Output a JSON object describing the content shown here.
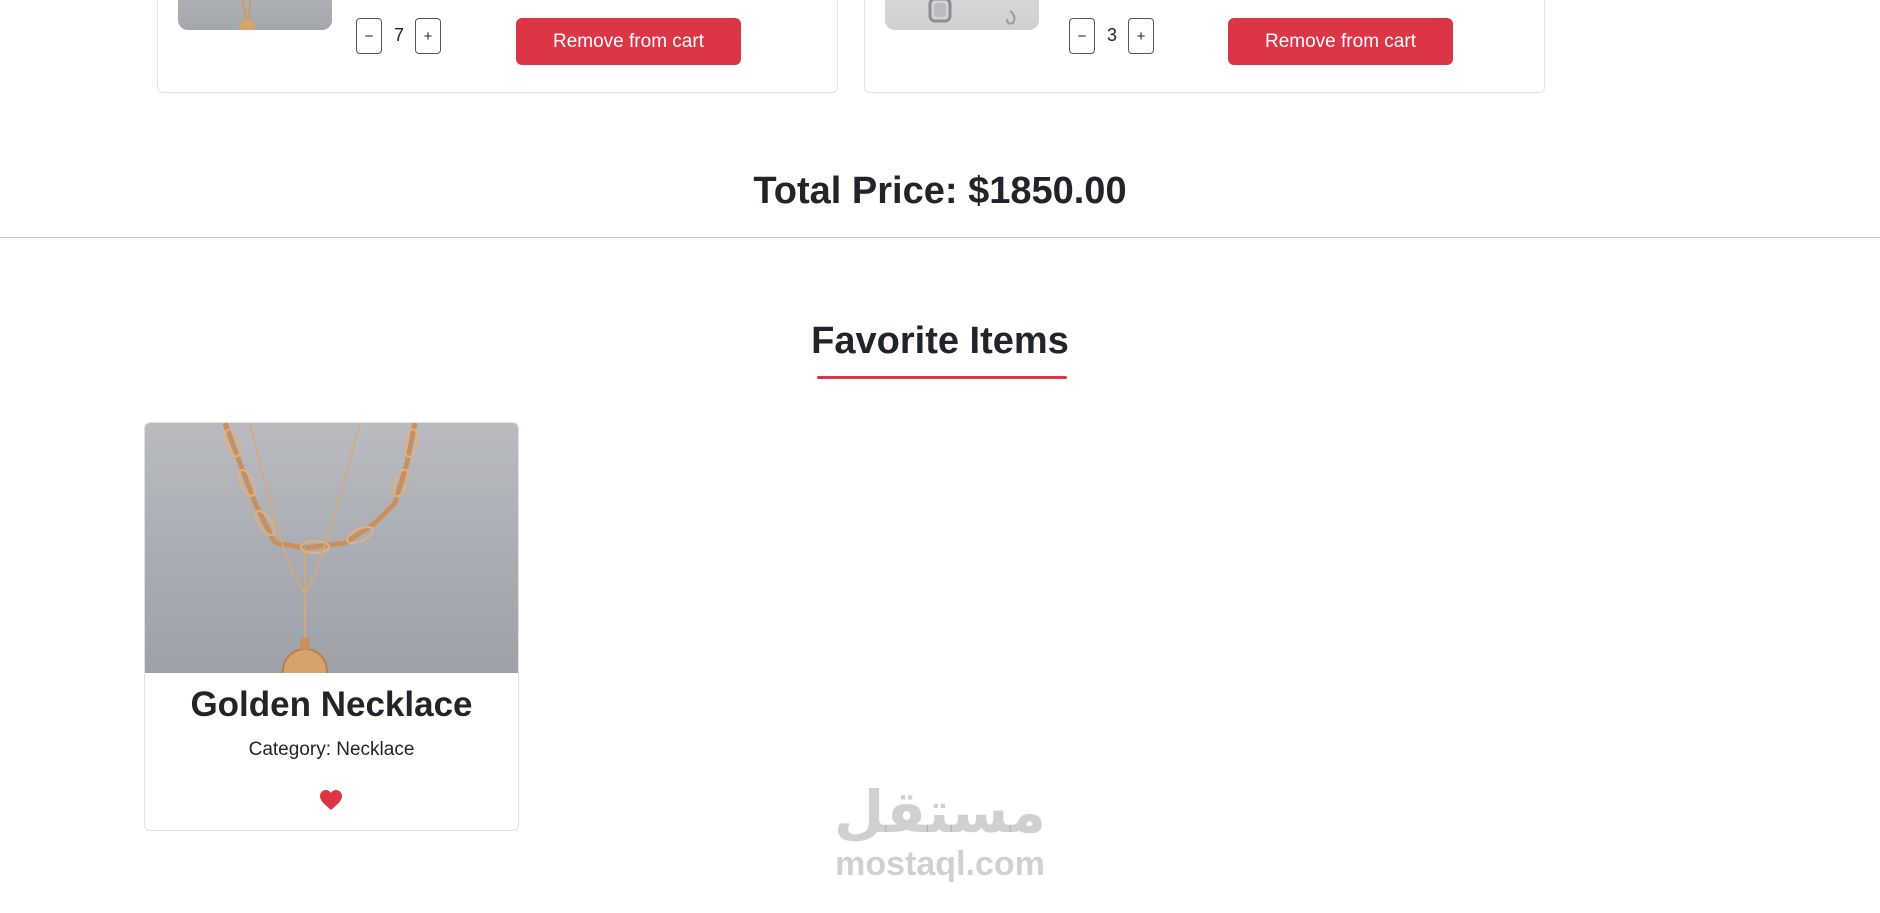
{
  "cart": {
    "items": [
      {
        "quantity": "7",
        "decrement_label": "−",
        "increment_label": "+",
        "remove_label": "Remove from cart"
      },
      {
        "quantity": "3",
        "decrement_label": "−",
        "increment_label": "+",
        "remove_label": "Remove from cart"
      }
    ],
    "total_label": "Total Price: $1850.00"
  },
  "favorites": {
    "heading": "Favorite Items",
    "items": [
      {
        "title": "Golden Necklace",
        "category": "Category: Necklace",
        "heart_color": "#dc3545",
        "icon": "heart-icon"
      }
    ]
  },
  "watermark": {
    "arabic": "مستقل",
    "latin": "mostaql.com"
  },
  "colors": {
    "danger": "#dc3545",
    "text": "#212529",
    "border": "#dee2e6"
  }
}
